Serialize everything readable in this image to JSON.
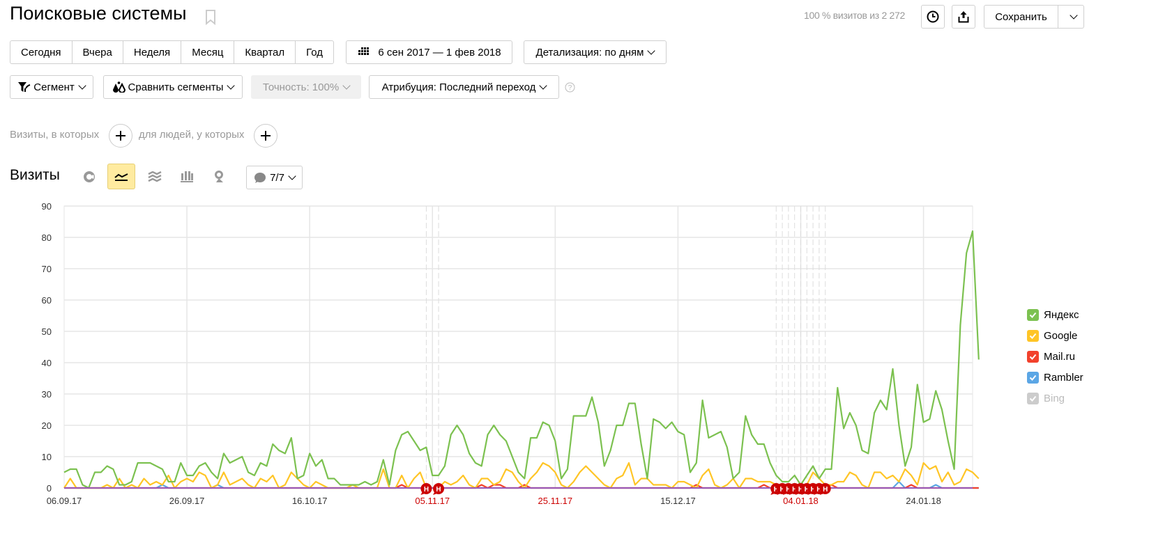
{
  "header": {
    "title": "Поисковые системы",
    "visits_info": "100 % визитов из 2 272",
    "save_label": "Сохранить"
  },
  "periods": [
    "Сегодня",
    "Вчера",
    "Неделя",
    "Месяц",
    "Квартал",
    "Год"
  ],
  "date_range": "6 сен 2017 — 1 фев 2018",
  "detail": "Детализация: по дням",
  "filters": {
    "segment": "Сегмент",
    "compare": "Сравнить сегменты",
    "accuracy": "Точность: 100%",
    "attribution": "Атрибуция: Последний переход"
  },
  "conditions": {
    "visits_label": "Визиты, в которых",
    "people_label": "для людей, у которых"
  },
  "chart_section": {
    "title": "Визиты",
    "annotations_label": "7/7"
  },
  "colors": {
    "yandex": "#7cc150",
    "google": "#ffc526",
    "mailru": "#f2412c",
    "rambler": "#5ba6e5",
    "bing": "#c8c8c8",
    "holiday": "#cc0000"
  },
  "chart_data": {
    "type": "line",
    "title": "Визиты",
    "xlabel": "",
    "ylabel": "",
    "x_start": "2017-09-06",
    "x_end": "2018-02-01",
    "ylim": [
      0,
      90
    ],
    "yticks": [
      0,
      10,
      20,
      30,
      40,
      50,
      60,
      70,
      80,
      90
    ],
    "xtick_labels": [
      {
        "label": "06.09.17",
        "day": 0,
        "holiday": false
      },
      {
        "label": "26.09.17",
        "day": 20,
        "holiday": false
      },
      {
        "label": "16.10.17",
        "day": 40,
        "holiday": false
      },
      {
        "label": "05.11.17",
        "day": 60,
        "holiday": true
      },
      {
        "label": "25.11.17",
        "day": 80,
        "holiday": true
      },
      {
        "label": "15.12.17",
        "day": 100,
        "holiday": false
      },
      {
        "label": "04.01.18",
        "day": 120,
        "holiday": true
      },
      {
        "label": "24.01.18",
        "day": 140,
        "holiday": false
      }
    ],
    "grid": true,
    "legend_position": "right",
    "holiday_markers": [
      59,
      61,
      116,
      117,
      118,
      119,
      120,
      121,
      122,
      123,
      124
    ],
    "series": [
      {
        "name": "Яндекс",
        "key": "yandex",
        "enabled": true,
        "values": [
          5,
          6,
          6,
          1,
          0,
          5,
          5,
          7,
          6,
          1,
          1,
          2,
          8,
          8,
          8,
          7,
          6,
          2,
          2,
          8,
          4,
          4,
          7,
          8,
          5,
          3,
          11,
          8,
          9,
          10,
          5,
          4,
          8,
          7,
          14,
          12,
          11,
          16,
          3,
          4,
          11,
          7,
          9,
          3,
          3,
          1,
          1,
          1,
          1,
          2,
          1,
          2,
          9,
          1,
          12,
          17,
          18,
          15,
          12,
          13,
          4,
          4,
          7,
          17,
          20,
          17,
          11,
          8,
          7,
          17,
          20,
          17,
          15,
          10,
          5,
          3,
          16,
          16,
          21,
          20,
          15,
          3,
          6,
          23,
          23,
          23,
          29,
          21,
          7,
          12,
          20,
          20,
          27,
          27,
          14,
          3,
          22,
          21,
          19,
          21,
          18,
          17,
          5,
          8,
          28,
          16,
          17,
          18,
          13,
          3,
          5,
          23,
          17,
          14,
          14,
          8,
          4,
          2,
          2,
          4,
          1,
          4,
          7,
          3,
          6,
          6,
          32,
          19,
          24,
          20,
          12,
          11,
          24,
          28,
          25,
          38,
          20,
          7,
          13,
          33,
          21,
          22,
          31,
          25,
          15,
          6,
          52,
          75,
          82,
          41
        ]
      },
      {
        "name": "Google",
        "key": "google",
        "enabled": true,
        "values": [
          0,
          3,
          0,
          0,
          0,
          0,
          0,
          1,
          0,
          3,
          0,
          1,
          0,
          3,
          1,
          2,
          1,
          4,
          0,
          2,
          3,
          2,
          5,
          4,
          0,
          1,
          5,
          1,
          2,
          3,
          1,
          0,
          3,
          2,
          4,
          0,
          1,
          5,
          3,
          1,
          0,
          2,
          1,
          0,
          0,
          0,
          0,
          1,
          0,
          0,
          0,
          0,
          6,
          0,
          0,
          4,
          0,
          3,
          5,
          0,
          0,
          0,
          2,
          1,
          2,
          4,
          1,
          0,
          3,
          3,
          1,
          2,
          6,
          5,
          2,
          0,
          3,
          5,
          8,
          7,
          5,
          1,
          0,
          2,
          5,
          7,
          5,
          3,
          1,
          0,
          3,
          4,
          8,
          1,
          3,
          3,
          1,
          1,
          1,
          0,
          2,
          2,
          1,
          0,
          4,
          6,
          1,
          0,
          1,
          3,
          0,
          3,
          3,
          2,
          2,
          2,
          1,
          1,
          1,
          1,
          0,
          1,
          5,
          3,
          1,
          1,
          2,
          2,
          5,
          4,
          1,
          0,
          5,
          5,
          3,
          4,
          2,
          6,
          4,
          1,
          8,
          6,
          7,
          2,
          5,
          1,
          2,
          6,
          5,
          3
        ]
      },
      {
        "name": "Mail.ru",
        "key": "mailru",
        "enabled": true,
        "values": [
          0,
          0,
          0,
          0,
          0,
          0,
          0,
          0,
          0,
          0,
          0,
          0,
          0,
          0,
          0,
          0,
          0,
          0,
          0,
          0,
          0,
          0,
          0,
          0,
          0,
          0,
          0,
          0,
          0,
          0,
          0,
          0,
          0,
          0,
          0,
          0,
          0,
          0,
          0,
          0,
          0,
          0,
          0,
          0,
          0,
          0,
          0,
          0,
          0,
          0,
          0,
          0,
          0,
          0,
          0,
          1,
          0,
          0,
          0,
          0,
          0,
          0,
          0,
          0,
          0,
          0,
          0,
          0,
          1,
          0,
          1,
          1,
          0,
          0,
          0,
          1,
          0,
          0,
          0,
          0,
          0,
          0,
          0,
          0,
          0,
          0,
          0,
          0,
          0,
          0,
          0,
          0,
          0,
          0,
          0,
          0,
          0,
          0,
          0,
          0,
          0,
          0,
          0,
          1,
          0,
          0,
          0,
          0,
          0,
          0,
          0,
          0,
          0,
          0,
          1,
          0,
          0,
          0,
          0,
          0,
          0,
          0,
          0,
          0,
          0,
          1,
          0,
          0,
          0,
          0,
          0,
          0,
          0,
          0,
          0,
          0,
          0,
          0,
          1,
          0,
          0,
          0,
          0,
          0,
          0,
          0,
          0,
          0,
          0,
          0
        ]
      },
      {
        "name": "Rambler",
        "key": "rambler",
        "enabled": true,
        "values": [
          0,
          0,
          0,
          0,
          0,
          0,
          0,
          0,
          0,
          0,
          0,
          0,
          0,
          0,
          0,
          0,
          1,
          0,
          0,
          0,
          0,
          0,
          0,
          0,
          0,
          1,
          0,
          0,
          0,
          0,
          0,
          0,
          0,
          0,
          0,
          0,
          0,
          0,
          0,
          0,
          0,
          0,
          0,
          0,
          0,
          0,
          0,
          0,
          0,
          0,
          0,
          0,
          0,
          0,
          0,
          0,
          0,
          0,
          0,
          0,
          0,
          0,
          0,
          0,
          0,
          0,
          0,
          0,
          0,
          0,
          0,
          0,
          0,
          0,
          0,
          0,
          0,
          0,
          0,
          0,
          0,
          0,
          0,
          0,
          0,
          0,
          0,
          0,
          0,
          0,
          0,
          0,
          0,
          0,
          0,
          0,
          0,
          0,
          0,
          0,
          0,
          0,
          0,
          0,
          0,
          0,
          0,
          0,
          0,
          0,
          0,
          0,
          0,
          0,
          0,
          0,
          0,
          0,
          0,
          0,
          0,
          0,
          0,
          0,
          0,
          0,
          0,
          0,
          0,
          0,
          0,
          0,
          0,
          0,
          0,
          0,
          2,
          0,
          0,
          0,
          0,
          0,
          1,
          0,
          0,
          0,
          0,
          0,
          0,
          0
        ]
      },
      {
        "name": "Bing",
        "key": "bing",
        "enabled": false,
        "values": []
      }
    ]
  }
}
